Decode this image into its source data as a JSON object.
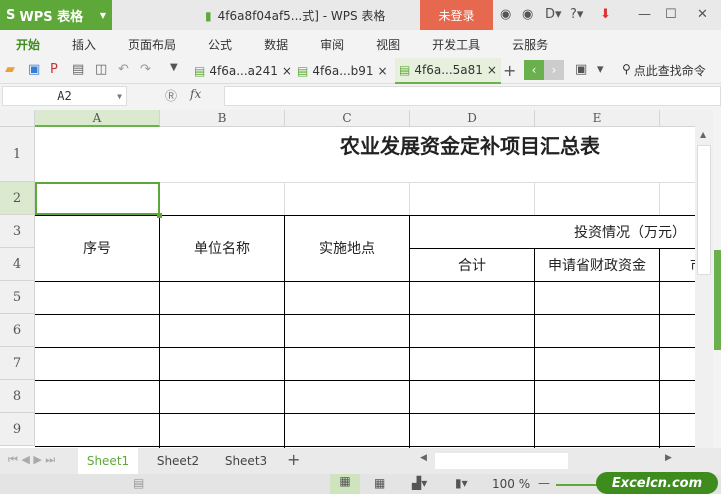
{
  "titlebar": {
    "app_label": "WPS 表格",
    "doc_title": "4f6a8f04af5...式] - WPS 表格",
    "login": "未登录"
  },
  "menu": [
    "开始",
    "插入",
    "页面布局",
    "公式",
    "数据",
    "审阅",
    "视图",
    "开发工具",
    "云服务"
  ],
  "doc_tabs": [
    "4f6a...a241",
    "4f6a...b91",
    "4f6a...5a81"
  ],
  "search_label": "点此查找命令",
  "formula": {
    "name_box": "A2",
    "fx": "fx",
    "value": ""
  },
  "columns": [
    "A",
    "B",
    "C",
    "D",
    "E"
  ],
  "rows": [
    "1",
    "2",
    "3",
    "4",
    "5",
    "6",
    "7",
    "8",
    "9"
  ],
  "sheet": {
    "title": "农业发展资金定补项目汇总表",
    "h_seq": "序号",
    "h_unit": "单位名称",
    "h_place": "实施地点",
    "h_invest": "投资情况（万元）",
    "h_total": "合计",
    "h_prov": "申请省财政资金",
    "h_city": "市"
  },
  "sheets": [
    "Sheet1",
    "Sheet2",
    "Sheet3"
  ],
  "status": {
    "zoom": "100 %"
  },
  "watermark": "Excelcn.com",
  "colors": {
    "accent": "#5ea83a",
    "login": "#e5684f"
  }
}
